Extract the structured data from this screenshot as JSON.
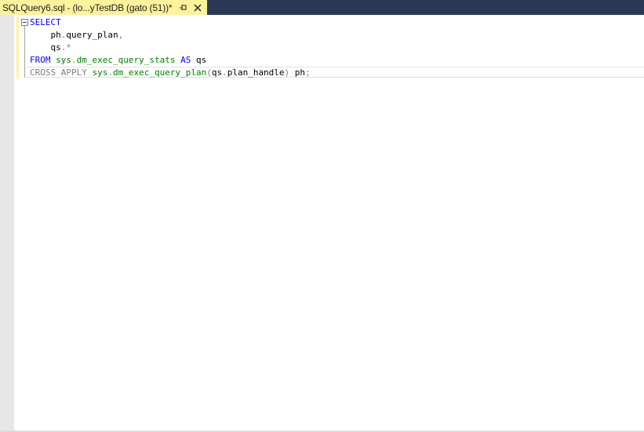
{
  "tab": {
    "title": "SQLQuery6.sql - (lo...yTestDB (gato (51))*",
    "pin_icon": "pin-icon",
    "close_icon": "close-icon"
  },
  "editor": {
    "lines": [
      {
        "parts": [
          {
            "t": "SELECT",
            "c": "kw"
          }
        ]
      },
      {
        "parts": [
          {
            "t": "    ph",
            "c": "id"
          },
          {
            "t": ".",
            "c": "gr"
          },
          {
            "t": "query_plan",
            "c": "id"
          },
          {
            "t": ",",
            "c": "gr"
          }
        ]
      },
      {
        "parts": [
          {
            "t": "    qs",
            "c": "id"
          },
          {
            "t": ".*",
            "c": "gr"
          }
        ]
      },
      {
        "parts": [
          {
            "t": "FROM ",
            "c": "kw"
          },
          {
            "t": "sys",
            "c": "sys"
          },
          {
            "t": ".",
            "c": "gr"
          },
          {
            "t": "dm_exec_query_stats",
            "c": "sys"
          },
          {
            "t": " AS ",
            "c": "kw"
          },
          {
            "t": "qs",
            "c": "id"
          }
        ]
      },
      {
        "parts": [
          {
            "t": "CROSS APPLY ",
            "c": "gr"
          },
          {
            "t": "sys",
            "c": "sys"
          },
          {
            "t": ".",
            "c": "gr"
          },
          {
            "t": "dm_exec_query_plan",
            "c": "sys"
          },
          {
            "t": "(",
            "c": "gr"
          },
          {
            "t": "qs",
            "c": "id"
          },
          {
            "t": ".",
            "c": "gr"
          },
          {
            "t": "plan_handle",
            "c": "id"
          },
          {
            "t": ")",
            "c": "gr"
          },
          {
            "t": " ph",
            "c": "id"
          },
          {
            "t": ";",
            "c": "gr"
          }
        ]
      }
    ]
  },
  "colors": {
    "tab_background": "#fff29d",
    "tabstrip_background": "#293955",
    "keyword": "#0000ff",
    "system_object": "#008000",
    "operator": "#808080"
  }
}
